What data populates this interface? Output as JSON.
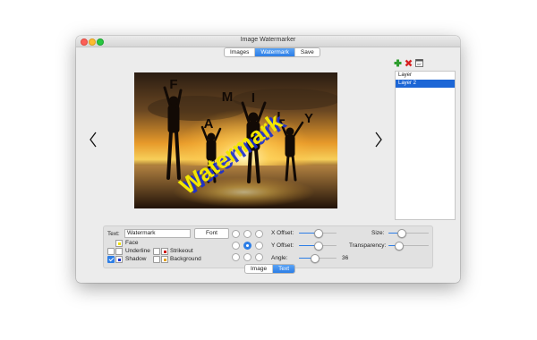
{
  "window": {
    "title": "Image Watermarker"
  },
  "top_tabs": [
    {
      "label": "Images",
      "active": false
    },
    {
      "label": "Watermark",
      "active": true
    },
    {
      "label": "Save",
      "active": false
    }
  ],
  "preview": {
    "watermark_text": "Watermark",
    "watermark_color": "#f2e600",
    "photo_letters": [
      "F",
      "A",
      "M",
      "I",
      "L",
      "Y"
    ]
  },
  "layer_toolbar": {
    "icons": [
      "add-icon",
      "delete-icon",
      "layer-window-icon"
    ]
  },
  "layers": {
    "header": "Layer",
    "items": [
      {
        "label": "Layer 2",
        "selected": true
      }
    ]
  },
  "text_panel": {
    "text_label": "Text:",
    "text_value": "Watermark",
    "font_button": "Font",
    "face_label": "Face",
    "underline_label": "Underline",
    "shadow_label": "Shadow",
    "shadow_checked": true,
    "strikeout_label": "Strikeout",
    "background_label": "Background",
    "anchor_selected": "center",
    "x_offset_label": "X Offset:",
    "x_offset_value": 0.5,
    "y_offset_label": "Y Offset:",
    "y_offset_value": 0.5,
    "angle_label": "Angle:",
    "angle_value": "36",
    "size_label": "Size:",
    "size_value": 0.3,
    "transparency_label": "Transparency:",
    "transparency_value": 0.25
  },
  "bottom_tabs": [
    {
      "label": "Image",
      "active": false
    },
    {
      "label": "Text",
      "active": true
    }
  ],
  "colors": {
    "accent": "#2d7ee6",
    "selection": "#1c66d6",
    "face_swatch": "#f0e000",
    "shadow_swatch": "#1a2fd0",
    "strikeout_swatch": "#d01818",
    "background_swatch": "#e0a020"
  }
}
